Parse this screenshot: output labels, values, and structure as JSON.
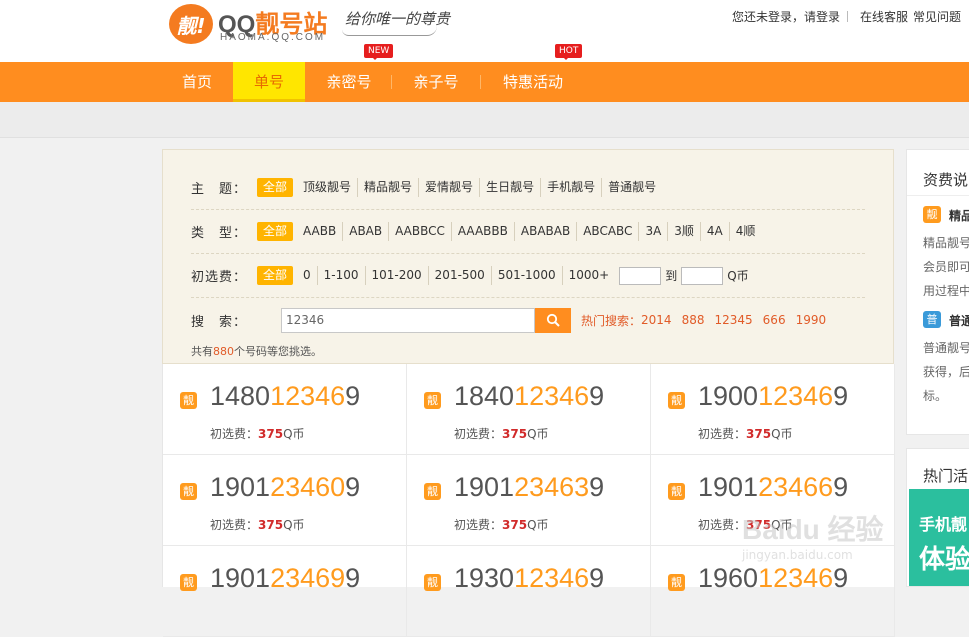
{
  "header": {
    "logo_mark": "靓!",
    "logo_qq": "QQ",
    "logo_name": "靓号站",
    "logo_url": "HAOMA.QQ.COM",
    "slogan": "给你唯一的尊贵",
    "login_status": "您还未登录，请登录",
    "online_service": "在线客服",
    "faq": "常见问题"
  },
  "nav": {
    "items": [
      {
        "label": "首页"
      },
      {
        "label": "单号"
      },
      {
        "label": "亲密号"
      },
      {
        "label": "亲子号"
      },
      {
        "label": "特惠活动"
      }
    ],
    "badge_new": "NEW",
    "badge_hot": "HOT",
    "colors": {
      "bar": "#ff8d1f",
      "active": "#ffe600"
    }
  },
  "filter": {
    "theme_label": "主　题：",
    "theme_options": [
      "全部",
      "顶级靓号",
      "精品靓号",
      "爱情靓号",
      "生日靓号",
      "手机靓号",
      "普通靓号"
    ],
    "type_label": "类　型：",
    "type_options": [
      "全部",
      "AABB",
      "ABAB",
      "AABBCC",
      "AAABBB",
      "ABABAB",
      "ABCABC",
      "3A",
      "3顺",
      "4A",
      "4顺"
    ],
    "fee_label": "初选费：",
    "fee_options": [
      "全部",
      "0",
      "1-100",
      "101-200",
      "201-500",
      "501-1000",
      "1000+"
    ],
    "fee_to": "到",
    "fee_unit": "Q币",
    "search_label": "搜　索：",
    "search_value": "12346",
    "hot_label": "热门搜索：",
    "hot_items": [
      "2014",
      "888",
      "12345",
      "666",
      "1990"
    ],
    "count_prefix": "共有",
    "count_value": "880",
    "count_suffix": "个号码等您挑选。"
  },
  "numbers": [
    {
      "pre": "1480",
      "hl": "12346",
      "post": "9",
      "fee_label": "初选费：",
      "price": "375",
      "unit": "Q币"
    },
    {
      "pre": "1840",
      "hl": "12346",
      "post": "9",
      "fee_label": "初选费：",
      "price": "375",
      "unit": "Q币"
    },
    {
      "pre": "1900",
      "hl": "12346",
      "post": "9",
      "fee_label": "初选费：",
      "price": "375",
      "unit": "Q币"
    },
    {
      "pre": "1901",
      "hl": "23460",
      "post": "9",
      "fee_label": "初选费：",
      "price": "375",
      "unit": "Q币"
    },
    {
      "pre": "1901",
      "hl": "23463",
      "post": "9",
      "fee_label": "初选费：",
      "price": "375",
      "unit": "Q币"
    },
    {
      "pre": "1901",
      "hl": "23466",
      "post": "9",
      "fee_label": "初选费：",
      "price": "375",
      "unit": "Q币"
    },
    {
      "pre": "1901",
      "hl": "23469",
      "post": "9",
      "fee_label": "",
      "price": "",
      "unit": ""
    },
    {
      "pre": "1930",
      "hl": "12346",
      "post": "9",
      "fee_label": "",
      "price": "",
      "unit": ""
    },
    {
      "pre": "1960",
      "hl": "12346",
      "post": "9",
      "fee_label": "",
      "price": "",
      "unit": ""
    }
  ],
  "number_tag": "靓",
  "sidebar": {
    "title": "资费说",
    "premium_tag": "靓",
    "premium_title": "精品",
    "premium_lines": [
      "精品靓号",
      "会员即可",
      "用过程中"
    ],
    "normal_tag": "普",
    "normal_title": "普通",
    "normal_lines": [
      "普通靓号",
      "获得，后",
      "标。"
    ],
    "hot_title": "热门活",
    "banner_line1": "手机靓",
    "banner_line2": "体验"
  },
  "watermark": {
    "text": "Baidu 经验",
    "sub": "jingyan.baidu.com"
  }
}
